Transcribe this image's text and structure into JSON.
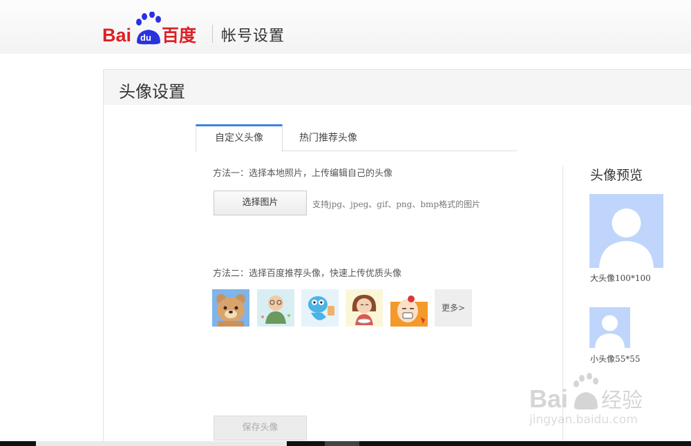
{
  "header": {
    "logo_text": "Bai百度",
    "logo_du": "du",
    "site_title": "帐号设置"
  },
  "panel": {
    "title": "头像设置"
  },
  "tabs": [
    {
      "label": "自定义头像",
      "active": true
    },
    {
      "label": "热门推荐头像",
      "active": false
    }
  ],
  "method_one": {
    "label": "方法一：选择本地照片，上传编辑自己的头像",
    "button": "选择图片",
    "hint": "支持jpg、jpeg、gif、png、bmp格式的图片"
  },
  "method_two": {
    "label": "方法二：选择百度推荐头像，快速上传优质头像",
    "thumbnails": [
      "bear-avatar",
      "boy-avatar",
      "blue-creature-avatar",
      "girl-avatar",
      "cartoon-face-avatar"
    ],
    "more_label": "更多>"
  },
  "save_button": "保存头像",
  "preview": {
    "title": "头像预览",
    "big_caption": "大头像100*100",
    "small_caption": "小头像55*55"
  },
  "watermark": {
    "text": "Bai经验",
    "domain": "jingyan.baidu.com"
  },
  "colors": {
    "accent_tab": "#3a83dd",
    "baidu_red": "#de1f25",
    "baidu_blue": "#2932e1",
    "avatar_bg": "#bfd5fb"
  }
}
